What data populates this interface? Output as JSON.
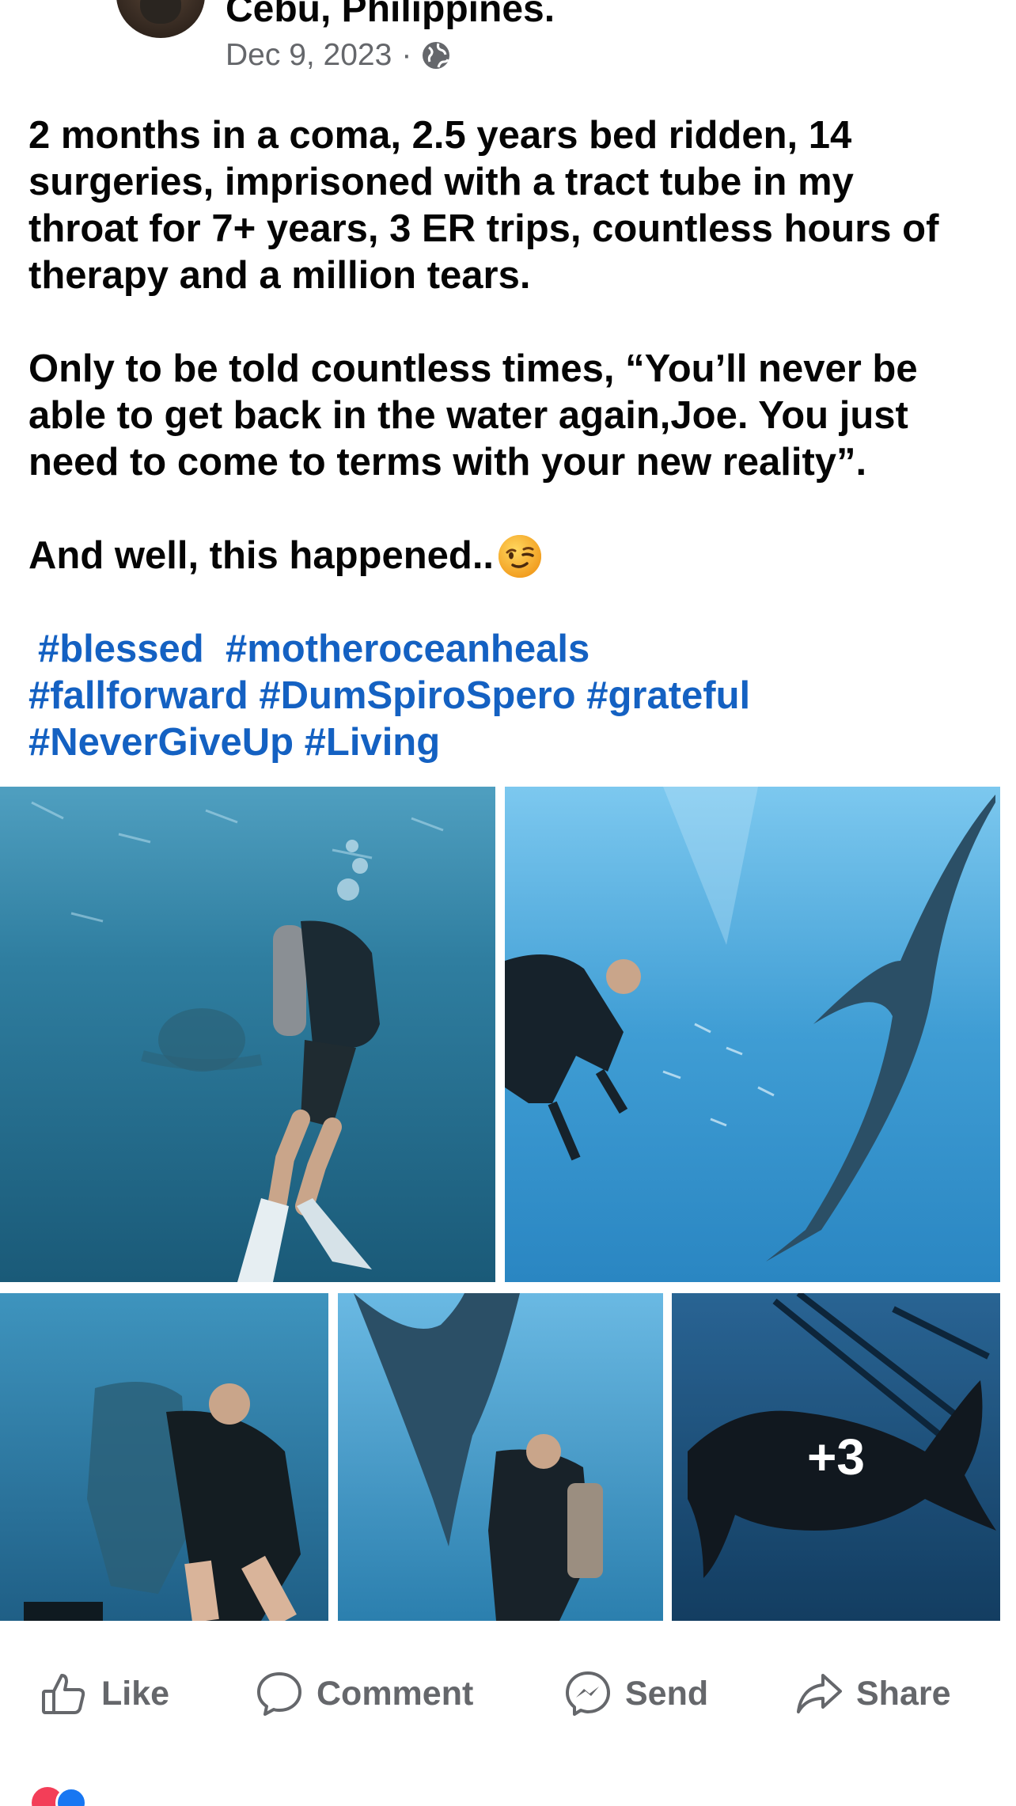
{
  "header": {
    "location": "Cebu, Philippines.",
    "date": "Dec 9, 2023",
    "separator": "·",
    "privacy_icon": "globe-icon"
  },
  "post": {
    "paragraph1": "2 months in a coma, 2.5 years bed ridden, 14\nsurgeries, imprisoned with a tract tube in my\nthroat for 7+ years, 3 ER trips, countless hours of\ntherapy and a million tears.",
    "paragraph2": "Only to be told countless times, “You’ll never be\nable to get back in the water again,Joe. You just\nneed to come to terms with your new reality”.",
    "paragraph3": "And well, this happened..",
    "emoji": "winking-face",
    "hashtags": [
      "#blessed",
      "#motheroceanheals",
      "#fallforward",
      "#DumSpiroSpero",
      "#grateful",
      "#NeverGiveUp",
      "#Living"
    ]
  },
  "photos": {
    "more_count": "+3"
  },
  "actions": {
    "like": "Like",
    "comment": "Comment",
    "send": "Send",
    "share": "Share"
  },
  "colors": {
    "text": "#050505",
    "secondary": "#65676b",
    "hashtag": "#1461c2",
    "ocean_light": "#4fb3e0",
    "ocean_dark": "#0e4f78"
  }
}
